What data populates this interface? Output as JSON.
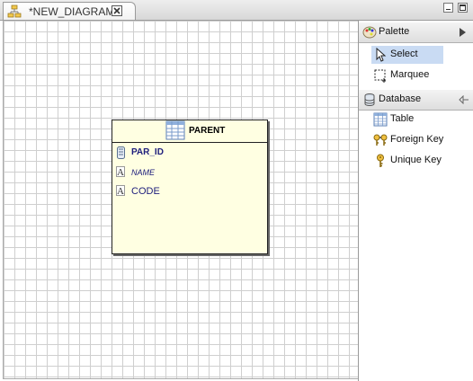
{
  "editor": {
    "tab_title": "*NEW_DIAGRAM"
  },
  "diagram": {
    "table": {
      "name": "PARENT",
      "columns": [
        {
          "name": "PAR_ID",
          "icon": "primary-key-column-icon"
        },
        {
          "name": "NAME",
          "icon": "text-column-icon"
        },
        {
          "name": "CODE",
          "icon": "text-column-icon"
        }
      ]
    }
  },
  "palette": {
    "title": "Palette",
    "tools": [
      {
        "label": "Select",
        "icon": "arrow-pointer-icon",
        "selected": true
      },
      {
        "label": "Marquee",
        "icon": "marquee-icon",
        "selected": false
      }
    ],
    "database_group": {
      "title": "Database",
      "items": [
        {
          "label": "Table",
          "icon": "table-icon"
        },
        {
          "label": "Foreign Key",
          "icon": "foreign-key-icon"
        },
        {
          "label": "Unique Key",
          "icon": "unique-key-icon"
        }
      ]
    }
  }
}
